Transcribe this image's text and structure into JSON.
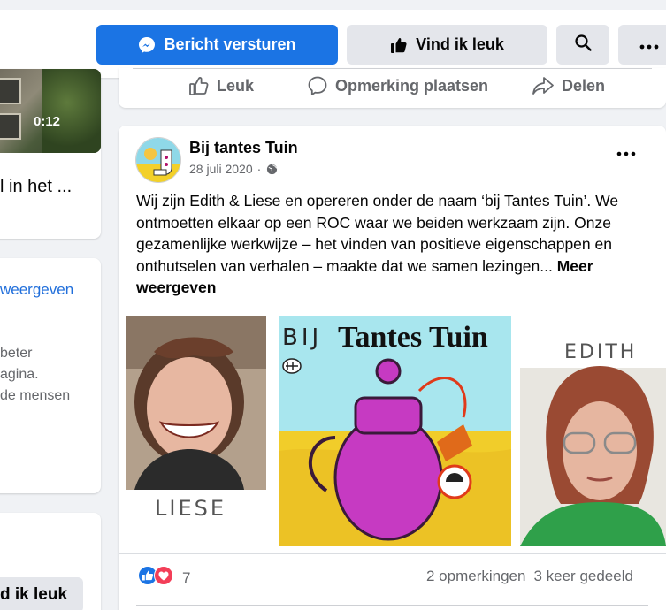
{
  "header": {
    "message_label": "Bericht versturen",
    "like_label": "Vind ik leuk"
  },
  "left": {
    "video_duration": "0:12",
    "card1_text": "l in het ...",
    "card2_link": "weergeven",
    "card2_lines": [
      "beter",
      "agina.",
      "de mensen"
    ],
    "card3_button": "d ik leuk"
  },
  "previous_post_actions": {
    "like": "Leuk",
    "comment": "Opmerking plaatsen",
    "share": "Delen"
  },
  "post": {
    "author": "Bij tantes Tuin",
    "date": "28 juli 2020",
    "dot": "·",
    "text": "Wij zijn Edith & Liese en opereren onder de naam  ‘bij Tantes Tuin’. We ontmoetten elkaar op een ROC waar we beiden werkzaam zijn. Onze gezamenlijke werkwijze – het vinden van positieve eigenschappen en onthutselen van verhalen – maakte dat we samen lezingen... ",
    "more_label": "Meer weergeven",
    "images": {
      "left_caption": "LIESE",
      "center_prefix": "BIJ",
      "center_title": "Tantes Tuin",
      "right_caption": "EDITH"
    },
    "reaction_count": "7",
    "comments": "2 opmerkingen",
    "shares": "3 keer gedeeld"
  },
  "colors": {
    "primary": "#1b74e4",
    "link": "#216fdb",
    "muted": "#65676b",
    "background": "#f0f2f5"
  },
  "icons": {
    "message": "messenger-icon",
    "like": "thumbs-up-icon",
    "search": "search-icon",
    "more": "more-horizontal-icon",
    "comment": "comment-bubble-icon",
    "share": "share-arrow-icon",
    "privacy": "globe-icon",
    "reactions": [
      "like-reaction-icon",
      "love-reaction-icon"
    ]
  }
}
